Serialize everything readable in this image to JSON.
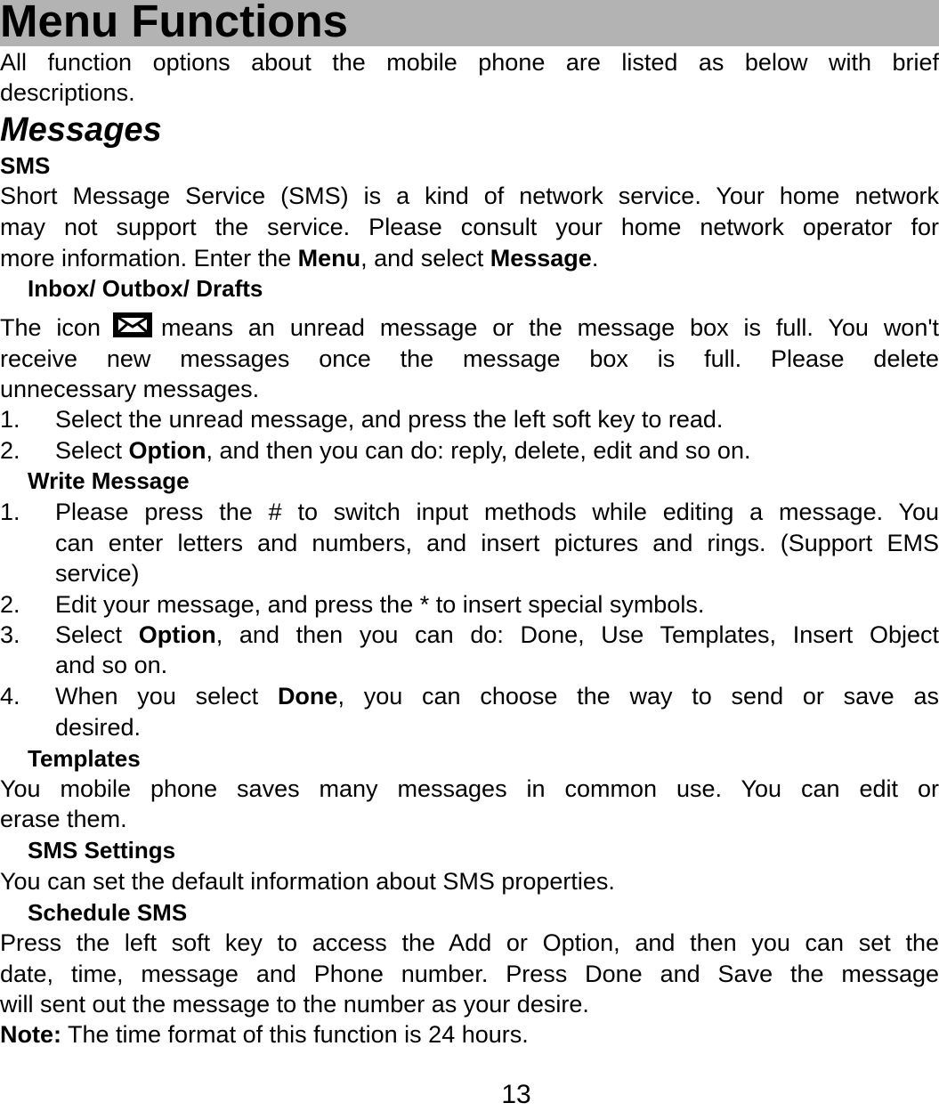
{
  "page": {
    "title": "Menu Functions",
    "title_bg": "#b3b3b3",
    "intro_line1": "All function options about the mobile phone are listed as below with brief",
    "intro_line2": "descriptions.",
    "section_heading": "Messages",
    "subsection_heading": "SMS",
    "sms_para": {
      "line1": "Short Message Service (SMS) is a kind of network service. Your home network",
      "line2": "may not support the service. Please consult your home network operator for",
      "line3_prefix": "more information. Enter the ",
      "line3_bold1": "Menu",
      "line3_mid": ", and select ",
      "line3_bold2": "Message",
      "line3_suffix": "."
    },
    "inbox": {
      "heading": "Inbox/ Outbox/ Drafts",
      "line1_prefix": "The icon",
      "icon": "envelope-icon",
      "line1_suffix": "means an unread message or the message box is full. You won't",
      "line2": "receive new messages once the message box is full. Please delete",
      "line3": "unnecessary messages.",
      "steps": [
        {
          "num": "1.",
          "text": "Select the unread message, and press the left soft key to read."
        },
        {
          "num": "2.",
          "prefix": "Select ",
          "bold": "Option",
          "suffix": ", and then you can do: reply, delete, edit and so on."
        }
      ]
    },
    "write": {
      "heading": "Write Message",
      "steps": [
        {
          "num": "1.",
          "line1": "Please press the # to switch input methods while editing a message. You",
          "line2": "can enter letters and numbers, and insert pictures and rings. (Support EMS",
          "line3": "service)"
        },
        {
          "num": "2.",
          "line1": "Edit your message, and press the * to insert special symbols."
        },
        {
          "num": "3.",
          "prefix": "Select ",
          "bold": "Option",
          "suffix": ", and then you can do: Done, Use Templates, Insert Object",
          "line2": "and so on."
        },
        {
          "num": "4.",
          "prefix": "When you select ",
          "bold": "Done",
          "suffix": ", you can choose the way to send or save as",
          "line2": "desired."
        }
      ]
    },
    "templates": {
      "heading": "Templates",
      "line1": "You mobile phone saves many messages in common use. You can edit or",
      "line2": "erase them."
    },
    "settings": {
      "heading": "SMS Settings",
      "line1": "You can set the default information about SMS properties."
    },
    "schedule": {
      "heading": "Schedule SMS",
      "line1": "Press the left soft key to access the Add or Option, and then you can set the",
      "line2": "date, time, message and Phone number. Press Done and Save the message",
      "line3": "will sent out the message to the number as your desire.",
      "note_label": "Note:",
      "note_text": " The time format of this function is 24 hours."
    },
    "page_number": "13"
  }
}
